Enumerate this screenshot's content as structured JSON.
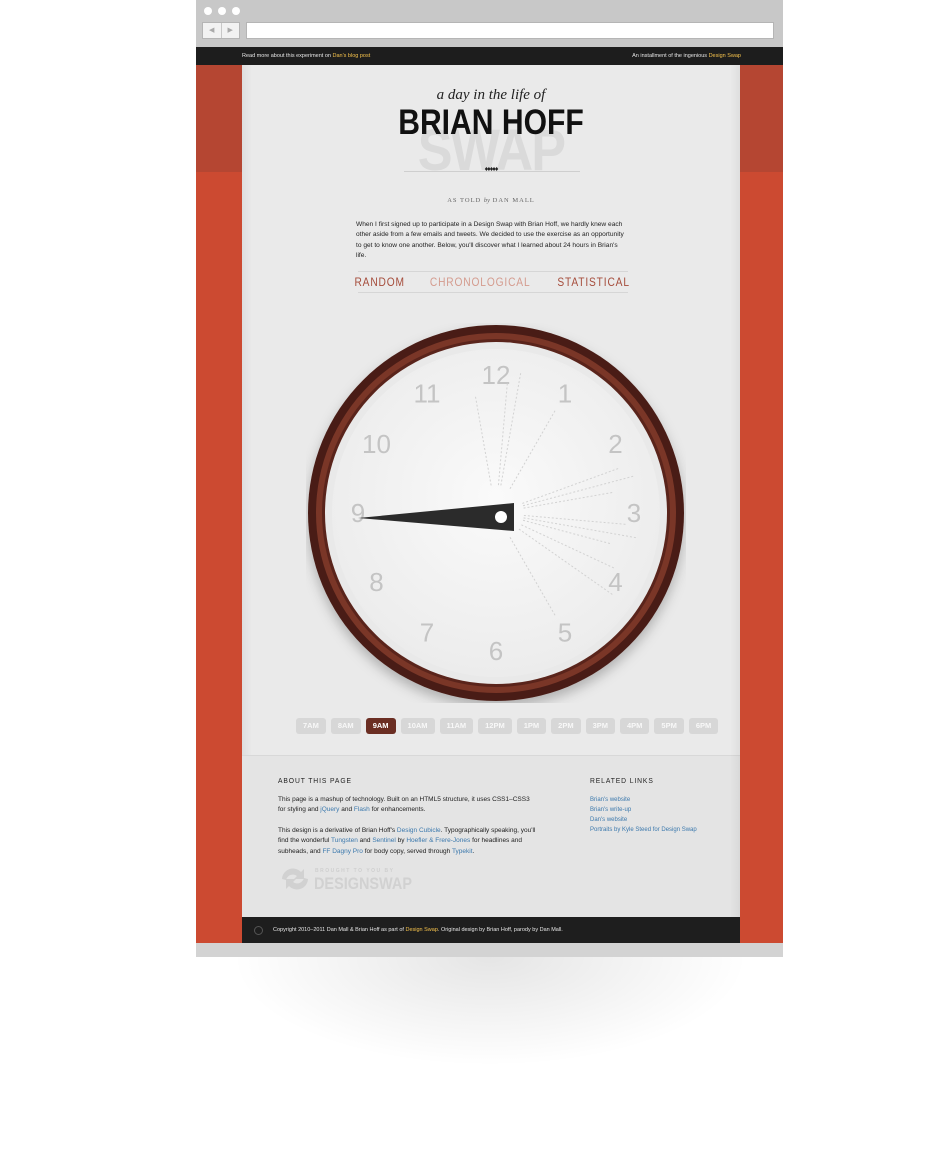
{
  "topbar": {
    "left_prefix": "Read more about this experiment on ",
    "left_link": "Dan's blog post",
    "right_prefix": "An installment of the ingenious ",
    "right_link": "Design Swap"
  },
  "header": {
    "tagline": "a day in the life of",
    "title": "BRIAN HOFF",
    "watermark": "SWAP",
    "diamonds": "♦♦♦♦♦",
    "byline_prefix": "AS TOLD",
    "byline_by": "by",
    "byline_name": "DAN MALL"
  },
  "intro": "When I first signed up to participate in a Design Swap with Brian Hoff, we hardly knew each other aside from a few emails and tweets. We decided to use the exercise as an opportunity to get to know one another. Below, you'll discover what I learned about 24 hours in Brian's life.",
  "modes": [
    {
      "label": "RANDOM",
      "state": "active"
    },
    {
      "label": "CHRONOLOGICAL",
      "state": "inactive"
    },
    {
      "label": "STATISTICAL",
      "state": "active"
    }
  ],
  "clock": {
    "numerals": [
      "12",
      "1",
      "2",
      "3",
      "4",
      "5",
      "6",
      "7",
      "8",
      "9",
      "10",
      "11"
    ],
    "hand_points_to": 9,
    "colors": {
      "rim": "#4a1e17",
      "rim_inner": "#7a3627",
      "face": "#f6f6f6",
      "numeral": "#c4c4c4",
      "hand": "#2b2b2b"
    }
  },
  "hours": [
    {
      "label": "7AM",
      "active": false
    },
    {
      "label": "8AM",
      "active": false
    },
    {
      "label": "9AM",
      "active": true
    },
    {
      "label": "10AM",
      "active": false
    },
    {
      "label": "11AM",
      "active": false
    },
    {
      "label": "12PM",
      "active": false
    },
    {
      "label": "1PM",
      "active": false
    },
    {
      "label": "2PM",
      "active": false
    },
    {
      "label": "3PM",
      "active": false
    },
    {
      "label": "4PM",
      "active": false
    },
    {
      "label": "5PM",
      "active": false
    },
    {
      "label": "6PM",
      "active": false
    }
  ],
  "about": {
    "heading": "ABOUT THIS PAGE",
    "p1_a": "This page is a mashup of technology. Built on an HTML5 structure, it uses CSS1–CSS3 for styling and ",
    "p1_jquery": "jQuery",
    "p1_b": " and ",
    "p1_flash": "Flash",
    "p1_c": " for enhancements.",
    "p2_a": "This design is a derivative of Brian Hoff's ",
    "p2_cubicle": "Design Cubicle",
    "p2_b": ". Typographically speaking, you'll find the wonderful ",
    "p2_tungsten": "Tungsten",
    "p2_c": " and ",
    "p2_sentinel": "Sentinel",
    "p2_d": " by ",
    "p2_hoefler": "Hoefler & Frere-Jones",
    "p2_e": " for headlines and subheads, and ",
    "p2_dagny": "FF Dagny Pro",
    "p2_f": " for body copy, served through ",
    "p2_typekit": "Typekit",
    "p2_g": ".",
    "logo_small": "BROUGHT TO YOU BY",
    "logo_big": "DESIGNSWAP"
  },
  "related": {
    "heading": "RELATED LINKS",
    "links": [
      "Brian's website",
      "Brian's write-up",
      "Dan's website",
      "Portraits by Kyle Steed for Design Swap"
    ]
  },
  "copyright": {
    "a": "Copyright 2010–2011 Dan Mall & Brian Hoff as part of ",
    "link": "Design Swap",
    "b": ". Original design by Brian Hoff, parody by Dan Mall."
  },
  "colors": {
    "brand_red": "#cc4a31",
    "dark_bar": "#1d1d1d",
    "accent_yellow": "#f5c24c",
    "link_blue": "#3c79ad"
  }
}
